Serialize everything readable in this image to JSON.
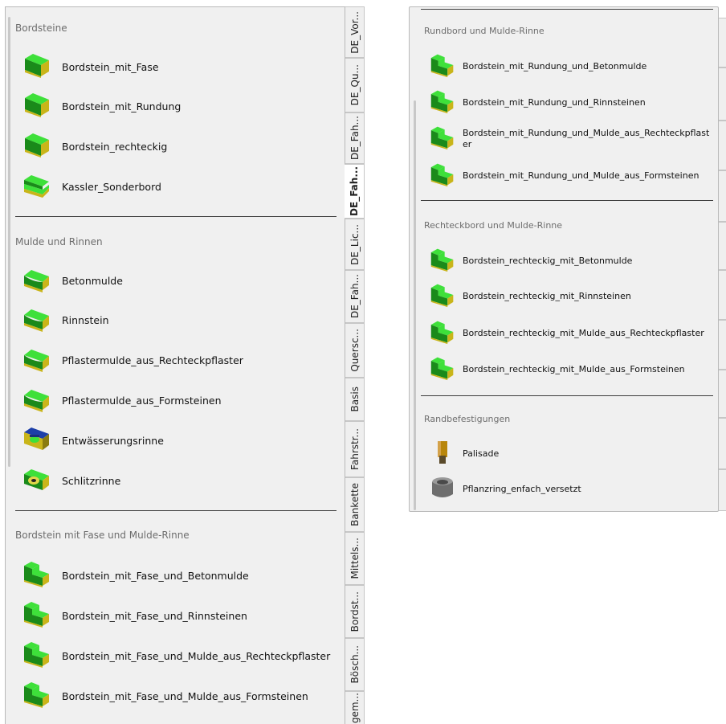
{
  "left_panel": {
    "sections": [
      {
        "title": "Bordsteine",
        "items": [
          {
            "label": "Bordstein_mit_Fase",
            "icon": "curb-chamfer-icon"
          },
          {
            "label": "Bordstein_mit_Rundung",
            "icon": "curb-rounded-icon"
          },
          {
            "label": "Bordstein_rechteckig",
            "icon": "curb-rect-icon"
          },
          {
            "label": "Kassler_Sonderbord",
            "icon": "curb-special-icon"
          }
        ]
      },
      {
        "title": "Mulde und Rinnen",
        "items": [
          {
            "label": "Betonmulde",
            "icon": "gutter-icon"
          },
          {
            "label": "Rinnstein",
            "icon": "gutter-icon"
          },
          {
            "label": "Pflastermulde_aus_Rechteckpflaster",
            "icon": "gutter-icon"
          },
          {
            "label": "Pflastermulde_aus_Formsteinen",
            "icon": "gutter-icon"
          },
          {
            "label": "Entwässerungsrinne",
            "icon": "drain-channel-icon"
          },
          {
            "label": "Schlitzrinne",
            "icon": "slot-channel-icon"
          }
        ]
      },
      {
        "title": "Bordstein mit Fase und Mulde-Rinne",
        "items": [
          {
            "label": "Bordstein_mit_Fase_und_Betonmulde",
            "icon": "curb-gutter-icon"
          },
          {
            "label": "Bordstein_mit_Fase_und_Rinnsteinen",
            "icon": "curb-gutter-icon"
          },
          {
            "label": "Bordstein_mit_Fase_und_Mulde_aus_Rechteckpflaster",
            "icon": "curb-gutter-icon"
          },
          {
            "label": "Bordstein_mit_Fase_und_Mulde_aus_Formsteinen",
            "icon": "curb-gutter-icon"
          }
        ]
      }
    ],
    "tabs": [
      "DE_Vor...",
      "DE_Qu...",
      "DE_Fah...",
      "DE_Fah...",
      "DE_Lic...",
      "DE_Fah...",
      "Quersc...",
      "Basis",
      "Fahrstr...",
      "Bankette",
      "Mittels...",
      "Bordst...",
      "Bösch...",
      "gem..."
    ],
    "active_tab_index": 3
  },
  "right_panel": {
    "sections": [
      {
        "title": "Rundbord und Mulde-Rinne",
        "items": [
          {
            "label": "Bordstein_mit_Rundung_und_Betonmulde",
            "icon": "curb-gutter-icon"
          },
          {
            "label": "Bordstein_mit_Rundung_und_Rinnsteinen",
            "icon": "curb-gutter-icon"
          },
          {
            "label": "Bordstein_mit_Rundung_und_Mulde_aus_Rechteckpflaster",
            "icon": "curb-gutter-icon"
          },
          {
            "label": "Bordstein_mit_Rundung_und_Mulde_aus_Formsteinen",
            "icon": "curb-gutter-icon"
          }
        ]
      },
      {
        "title": "Rechteckbord und Mulde-Rinne",
        "items": [
          {
            "label": "Bordstein_rechteckig_mit_Betonmulde",
            "icon": "curb-gutter-icon"
          },
          {
            "label": "Bordstein_rechteckig_mit_Rinnsteinen",
            "icon": "curb-gutter-icon"
          },
          {
            "label": "Bordstein_rechteckig_mit_Mulde_aus_Rechteckpflaster",
            "icon": "curb-gutter-icon"
          },
          {
            "label": "Bordstein_rechteckig_mit_Mulde_aus_Formsteinen",
            "icon": "curb-gutter-icon"
          }
        ]
      },
      {
        "title": "Randbefestigungen",
        "items": [
          {
            "label": "Palisade",
            "icon": "palisade-icon"
          },
          {
            "label": "Pflanzring_enfach_versetzt",
            "icon": "planter-ring-icon"
          }
        ]
      }
    ]
  },
  "colors": {
    "panel_bg": "#f0f0f0",
    "icon_green_light": "#3ee03a",
    "icon_green_dark": "#1a8a1a",
    "icon_concrete": "#c9b51a",
    "icon_blue": "#1d3fa8"
  }
}
